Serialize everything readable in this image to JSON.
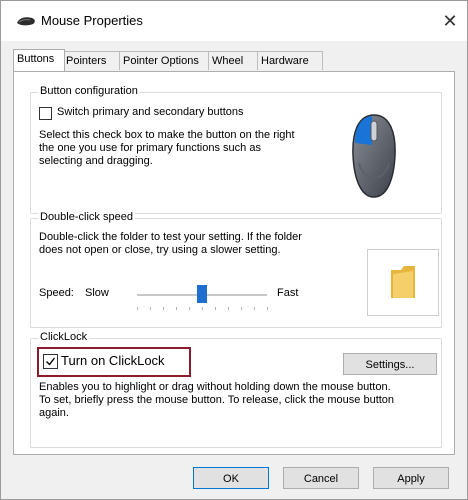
{
  "window": {
    "title": "Mouse Properties",
    "close_label": "✕"
  },
  "tabs": [
    {
      "label": "Buttons",
      "active": true
    },
    {
      "label": "Pointers",
      "active": false
    },
    {
      "label": "Pointer Options",
      "active": false
    },
    {
      "label": "Wheel",
      "active": false
    },
    {
      "label": "Hardware",
      "active": false
    }
  ],
  "button_config": {
    "title": "Button configuration",
    "checkbox_label": "Switch primary and secondary buttons",
    "checked": false,
    "description_lines": [
      "Select this check box to make the button on the right",
      "the one you use for primary functions such as",
      "selecting and dragging."
    ]
  },
  "double_click": {
    "title": "Double-click speed",
    "description_lines": [
      "Double-click the folder to test your setting. If the folder",
      "does not open or close, try using a slower setting."
    ],
    "speed_label": "Speed:",
    "slow_label": "Slow",
    "fast_label": "Fast",
    "slider_value": 0.5
  },
  "clicklock": {
    "title": "ClickLock",
    "checkbox_label": "Turn on ClickLock",
    "checked": true,
    "settings_label": "Settings...",
    "description_lines": [
      "Enables you to highlight or drag without holding down the mouse button.",
      "To set, briefly press the mouse button. To release, click the mouse button",
      "again."
    ]
  },
  "footer": {
    "ok_label": "OK",
    "cancel_label": "Cancel",
    "apply_label": "Apply"
  },
  "colors": {
    "accent": "#1e6fcf",
    "highlight_border": "#8c1c2c"
  }
}
